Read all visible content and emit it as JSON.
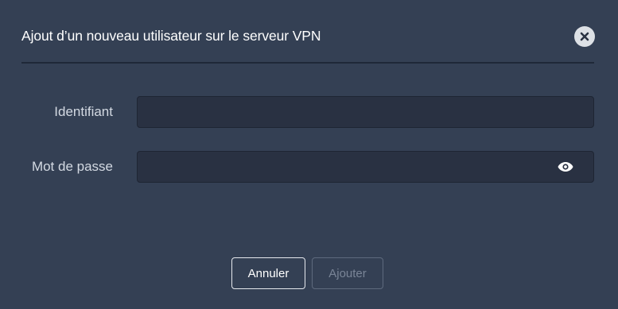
{
  "dialog": {
    "title": "Ajout d’un nouveau utilisateur sur le serveur VPN",
    "close_icon": "close-icon"
  },
  "form": {
    "username": {
      "label": "Identifiant",
      "value": "",
      "placeholder": ""
    },
    "password": {
      "label": "Mot de passe",
      "value": "",
      "placeholder": "",
      "toggle_icon": "eye-icon"
    }
  },
  "actions": {
    "cancel_label": "Annuler",
    "add_label": "Ajouter",
    "add_disabled": true
  },
  "colors": {
    "background": "#344054",
    "input_background": "#293142",
    "text": "#ffffff"
  }
}
